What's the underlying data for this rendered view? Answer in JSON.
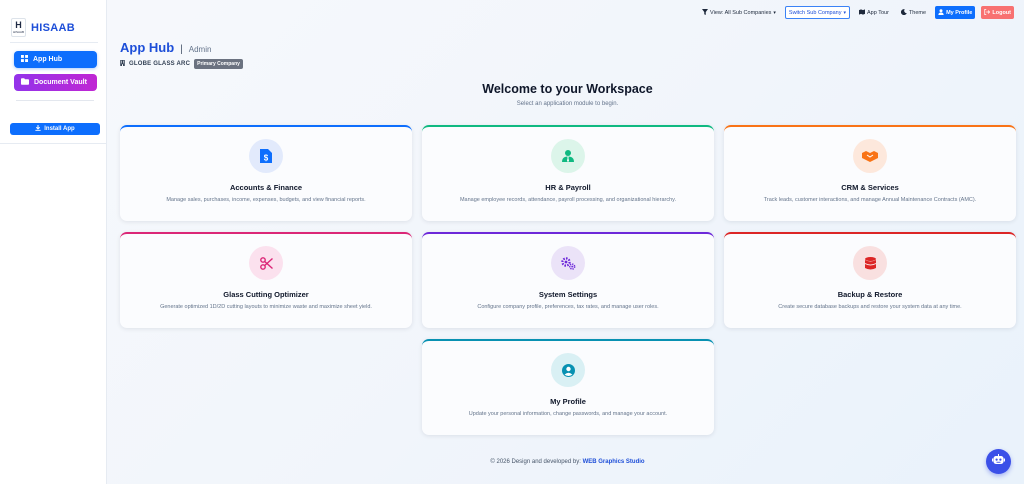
{
  "brand": {
    "name": "HISAAB",
    "logo_letter": "H",
    "logo_sub": "HISAAB"
  },
  "sidebar": {
    "items": [
      {
        "label": "App Hub",
        "icon": "grid-icon",
        "active": true
      },
      {
        "label": "Document Vault",
        "icon": "folder-icon"
      }
    ],
    "install_label": "Install App"
  },
  "topbar": {
    "view_filter": "View: All Sub Companies",
    "switch_label": "Switch Sub Company",
    "tour_label": "App Tour",
    "theme_label": "Theme",
    "profile_label": "My Profile",
    "logout_label": "Logout"
  },
  "header": {
    "title": "App Hub",
    "separator": "|",
    "role": "Admin",
    "company": "GLOBE GLASS ARC",
    "company_badge": "Primary Company"
  },
  "welcome": {
    "title": "Welcome to your Workspace",
    "subtitle": "Select an application module to begin."
  },
  "modules": [
    {
      "title": "Accounts & Finance",
      "desc": "Manage sales, purchases, income, expenses, budgets, and view financial reports.",
      "icon": "invoice-dollar-icon",
      "color": "#0d6efd",
      "bg": "#e2eafc"
    },
    {
      "title": "HR & Payroll",
      "desc": "Manage employee records, attendance, payroll processing, and organizational hierarchy.",
      "icon": "user-tie-icon",
      "color": "#10b981",
      "bg": "#dcf5ea"
    },
    {
      "title": "CRM & Services",
      "desc": "Track leads, customer interactions, and manage Annual Maintenance Contracts (AMC).",
      "icon": "handshake-icon",
      "color": "#f97316",
      "bg": "#fde8dc"
    },
    {
      "title": "Glass Cutting Optimizer",
      "desc": "Generate optimized 1D/2D cutting layouts to minimize waste and maximize sheet yield.",
      "icon": "scissors-icon",
      "color": "#db2777",
      "bg": "#fbe1ee"
    },
    {
      "title": "System Settings",
      "desc": "Configure company profile, preferences, tax rates, and manage user roles.",
      "icon": "gears-icon",
      "color": "#6d28d9",
      "bg": "#ebe3f8"
    },
    {
      "title": "Backup & Restore",
      "desc": "Create secure database backups and restore your system data at any time.",
      "icon": "database-icon",
      "color": "#dc2626",
      "bg": "#f9e0e0"
    },
    {
      "title": "My Profile",
      "desc": "Update your personal information, change passwords, and manage your account.",
      "icon": "user-circle-icon",
      "color": "#0891b2",
      "bg": "#d9f0f4"
    }
  ],
  "footer": {
    "text": "© 2026 Design and developed by:",
    "link": "WEB Graphics Studio"
  },
  "colors": {
    "accent": "#0d6efd",
    "logout": "#f87171",
    "vault_gradient_start": "#9333ea",
    "chatbot": "#3b50e8"
  }
}
